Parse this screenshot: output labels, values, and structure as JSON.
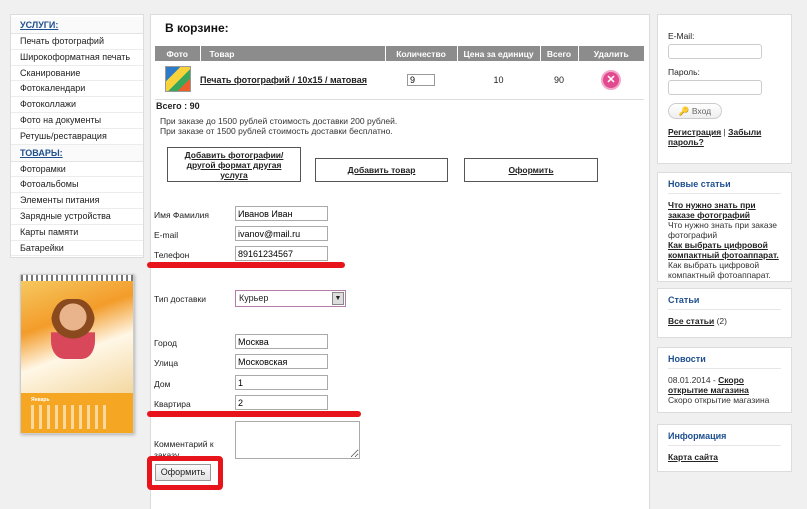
{
  "services": {
    "title": "УСЛУГИ:",
    "items": [
      "Печать фотографий",
      "Широкоформатная печать",
      "Сканирование",
      "Фотокалендари",
      "Фотоколлажи",
      "Фото на документы",
      "Ретушь/реставрация"
    ]
  },
  "goods": {
    "title": "ТОВАРЫ:",
    "items": [
      "Фоторамки",
      "Фотоальбомы",
      "Элементы питания",
      "Зарядные устройства",
      "Карты памяти",
      "Батарейки"
    ]
  },
  "calendar": {
    "month": "Январь"
  },
  "cart": {
    "title": "В корзине:",
    "headers": [
      "Фото",
      "Товар",
      "Количество",
      "Цена за единицу",
      "Всего",
      "Удалить"
    ],
    "row": {
      "name": "Печать фотографий / 10х15 / матовая",
      "qty": "9",
      "price": "10",
      "total": "90",
      "delete": "✕"
    },
    "total": "Всего : 90",
    "note1": "При заказе до 1500 рублей стоимость доставки 200 рублей.",
    "note2": "При заказе от 1500 рублей стоимость доставки бесплатно.",
    "btn_add_photos": "Добавить фотографии/ другой формат другая услуга",
    "btn_add_product": "Добавить товар",
    "btn_checkout": "Оформить"
  },
  "form": {
    "name_label": "Имя Фамилия",
    "name_value": "Иванов Иван",
    "email_label": "E-mail",
    "email_value": "ivanov@mail.ru",
    "phone_label": "Телефон",
    "phone_value": "89161234567",
    "delivery_label": "Тип доставки",
    "delivery_value": "Курьер",
    "city_label": "Город",
    "city_value": "Москва",
    "street_label": "Улица",
    "street_value": "Московская",
    "house_label": "Дом",
    "house_value": "1",
    "apt_label": "Квартира",
    "apt_value": "2",
    "comment_label": "Комментарий к заказу",
    "submit": "Оформить"
  },
  "login": {
    "email_label": "E-Mail:",
    "password_label": "Пароль:",
    "login_btn": "Вход",
    "register_link": "Регистрация",
    "separator": "|",
    "forgot_link": "Забыли пароль?"
  },
  "news_articles": {
    "title": "Новые статьи",
    "a1_link": "Что нужно знать при заказе фотографий",
    "a1_text": "Что нужно знать при заказе фотографий",
    "a2_link": "Как выбрать цифровой компактный фотоаппарат.",
    "a2_text": "Как выбрать цифровой компактный фотоаппарат."
  },
  "articles": {
    "title": "Статьи",
    "link": "Все статьи",
    "count": "(2)"
  },
  "news": {
    "title": "Новости",
    "date": "08.01.2014 -",
    "link": "Скоро открытие магазина",
    "text": "Скоро открытие магазина"
  },
  "info": {
    "title": "Информация",
    "link": "Карта сайта"
  },
  "colors": {
    "accent": "#1e4f8f",
    "highlight": "#e8141c",
    "delete": "#e24a8f"
  }
}
